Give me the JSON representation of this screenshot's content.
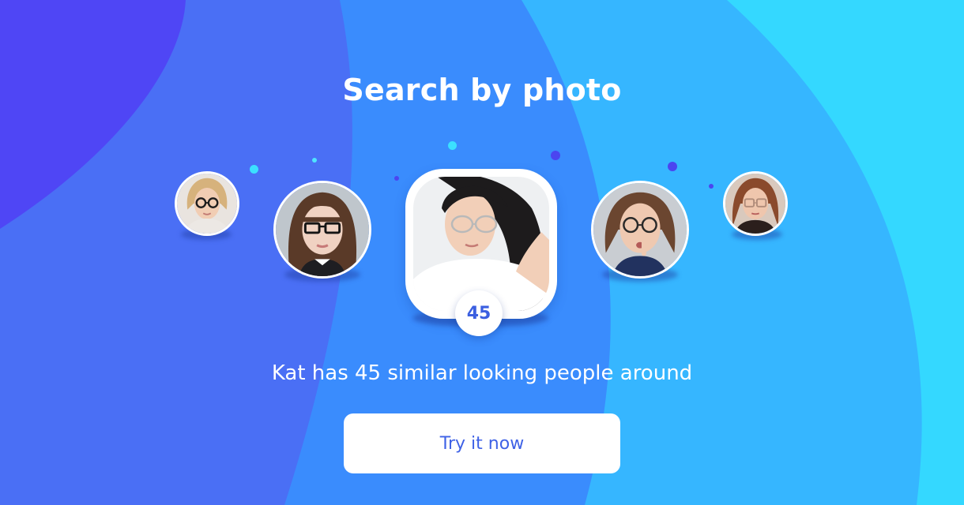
{
  "header": {
    "title": "Search by photo"
  },
  "main": {
    "match_count": "45",
    "summary": "Kat has 45 similar looking people around"
  },
  "cta": {
    "label": "Try it now"
  },
  "colors": {
    "brand_blue": "#3f62e6",
    "bg_purple": "#4f46f5",
    "bg_blue": "#3a8cfd",
    "bg_cyan": "#34d8ff"
  },
  "avatars": [
    {
      "name": "avatar-far-left"
    },
    {
      "name": "avatar-left"
    },
    {
      "name": "avatar-main"
    },
    {
      "name": "avatar-right"
    },
    {
      "name": "avatar-far-right"
    }
  ]
}
